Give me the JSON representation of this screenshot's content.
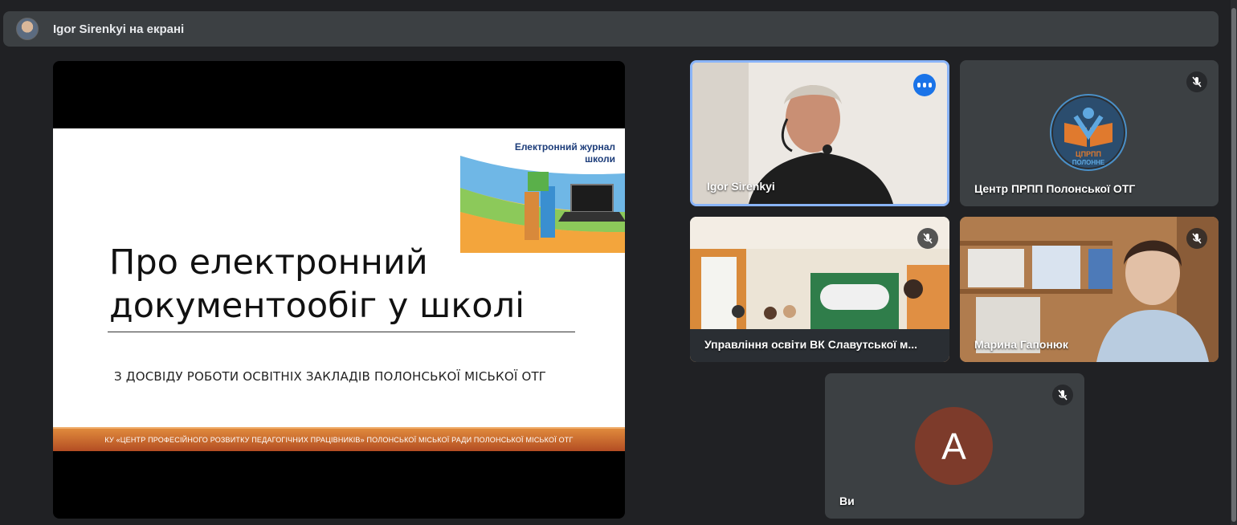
{
  "header": {
    "title": "Igor Sirenkyi на екрані"
  },
  "presentation": {
    "logo_line1": "Електронний журнал",
    "logo_line2": "школи",
    "heading_line1": "Про електронний",
    "heading_line2": "документообіг у школі",
    "subtitle": "З ДОСВІДУ РОБОТИ ОСВІТНІХ ЗАКЛАДІВ ПОЛОНСЬКОЇ МІСЬКОЇ ОТГ",
    "footer": "КУ «ЦЕНТР ПРОФЕСІЙНОГО РОЗВИТКУ ПЕДАГОГІЧНИХ ПРАЦІВНИКІВ» ПОЛОНСЬКОЇ МІСЬКОЇ РАДИ ПОЛОНСЬКОЇ МІСЬКОЇ ОТГ"
  },
  "participants": [
    {
      "name": "Igor Sirenkyi",
      "speaking": true
    },
    {
      "name": "Центр ПРПП Полонської ОТГ",
      "muted": true
    },
    {
      "name": "Управління освіти ВК Славутської м...",
      "muted": true
    },
    {
      "name": "Марина Гапонюк",
      "muted": true
    },
    {
      "name": "Ви",
      "avatar_letter": "A",
      "muted": true
    }
  ],
  "org_logo": {
    "text_top": "ЦПРПП",
    "text_bottom": "ПОЛОННЕ"
  },
  "colors": {
    "background": "#202124",
    "tile": "#3c4043",
    "active_border": "#8ab4f8",
    "speaking": "#1a73e8",
    "avatar": "#7d3b2b"
  }
}
